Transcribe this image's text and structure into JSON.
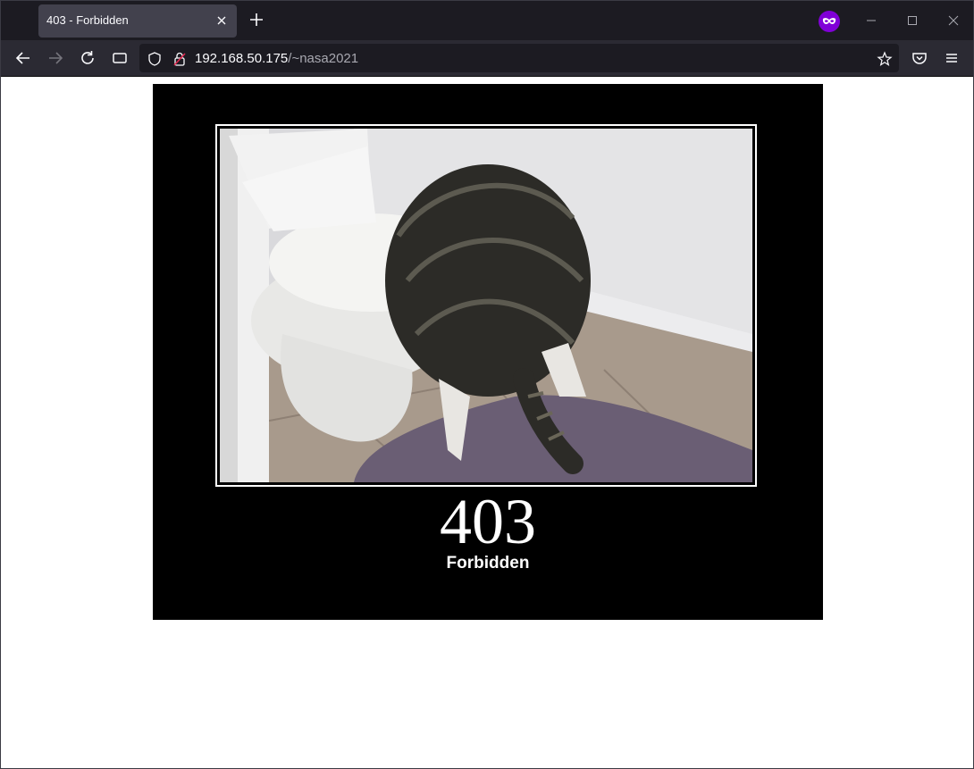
{
  "browser": {
    "tab": {
      "title": "403 - Forbidden"
    },
    "url": {
      "host": "192.168.50.175",
      "path": "/~nasa2021"
    },
    "icons": {
      "back": "arrow-left-icon",
      "forward": "arrow-right-icon",
      "reload": "reload-icon",
      "reader": "reader-view-icon",
      "shield": "shield-icon",
      "lock": "lock-insecure-icon",
      "bookmark": "star-icon",
      "pocket": "pocket-icon",
      "menu": "hamburger-icon",
      "private": "private-browsing-icon"
    },
    "colors": {
      "toolbar": "#2b2a33",
      "tabstrip": "#1c1b22",
      "active_tab": "#42414d",
      "private": "#8000d7"
    }
  },
  "page": {
    "status_code": "403",
    "status_text": "Forbidden",
    "image_description_icon": "cat-in-toilet-photo"
  }
}
